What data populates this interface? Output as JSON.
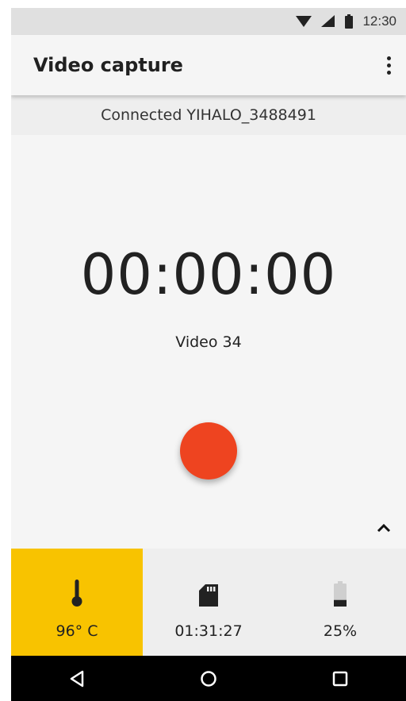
{
  "status_bar": {
    "time": "12:30",
    "icons": [
      "wifi-icon",
      "signal-icon",
      "battery-icon"
    ]
  },
  "app_bar": {
    "title": "Video capture",
    "menu_icon": "more-vert-icon"
  },
  "connection": {
    "text": "Connected YIHALO_3488491"
  },
  "capture": {
    "timer": "00:00:00",
    "video_name": "Video 34",
    "record_color": "#ee4420"
  },
  "stats": [
    {
      "icon": "thermometer-icon",
      "value": "96° C",
      "active": true
    },
    {
      "icon": "sd-card-icon",
      "value": "01:31:27",
      "active": false
    },
    {
      "icon": "battery-icon",
      "value": "25%",
      "active": false,
      "level": 0.25
    }
  ],
  "colors": {
    "accent": "#f8c300",
    "record": "#ee4420"
  },
  "nav_bar": {
    "buttons": [
      "back-icon",
      "home-icon",
      "recents-icon"
    ]
  }
}
